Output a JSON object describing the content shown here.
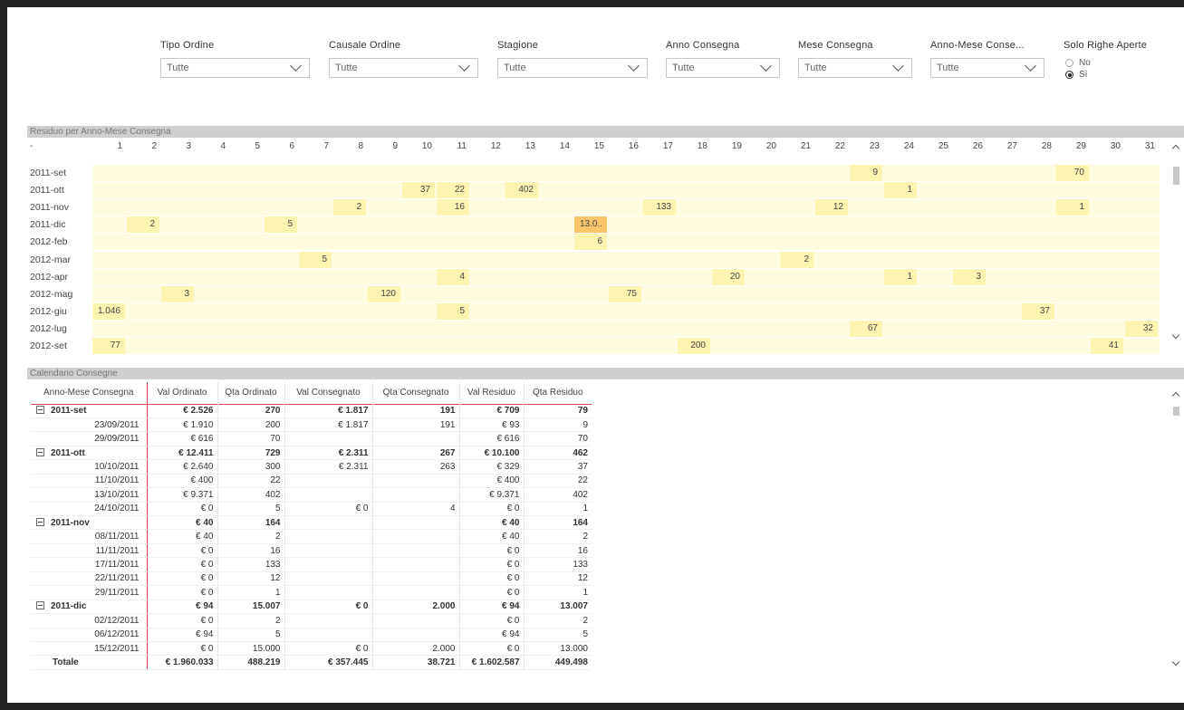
{
  "slicers": [
    {
      "title": "Tipo Ordine",
      "value": "Tutte"
    },
    {
      "title": "Causale Ordine",
      "value": "Tutte"
    },
    {
      "title": "Stagione",
      "value": "Tutte"
    },
    {
      "title": "Anno Consegna",
      "value": "Tutte"
    },
    {
      "title": "Mese Consegna",
      "value": "Tutte"
    },
    {
      "title": "Anno-Mese Conse...",
      "value": "Tutte"
    }
  ],
  "radio_slicer": {
    "title": "Solo Righe Aperte",
    "options": [
      {
        "label": "No",
        "selected": false
      },
      {
        "label": "Sì",
        "selected": true
      }
    ]
  },
  "matrix": {
    "title": "Residuo per Anno-Mese Consegna",
    "corner": "-",
    "days": [
      "1",
      "2",
      "3",
      "4",
      "5",
      "6",
      "7",
      "8",
      "9",
      "10",
      "11",
      "12",
      "13",
      "14",
      "15",
      "16",
      "17",
      "18",
      "19",
      "20",
      "21",
      "22",
      "23",
      "24",
      "25",
      "26",
      "27",
      "28",
      "29",
      "30",
      "31"
    ],
    "rows": [
      {
        "label": "2011-set",
        "cells": [
          {
            "day": 23,
            "value": "9"
          },
          {
            "day": 29,
            "value": "70"
          }
        ]
      },
      {
        "label": "2011-ott",
        "cells": [
          {
            "day": 10,
            "value": "37"
          },
          {
            "day": 11,
            "value": "22"
          },
          {
            "day": 13,
            "value": "402"
          },
          {
            "day": 24,
            "value": "1"
          }
        ]
      },
      {
        "label": "2011-nov",
        "cells": [
          {
            "day": 8,
            "value": "2"
          },
          {
            "day": 11,
            "value": "16"
          },
          {
            "day": 17,
            "value": "133"
          },
          {
            "day": 22,
            "value": "12"
          },
          {
            "day": 29,
            "value": "1"
          }
        ]
      },
      {
        "label": "2011-dic",
        "cells": [
          {
            "day": 2,
            "value": "2"
          },
          {
            "day": 6,
            "value": "5"
          },
          {
            "day": 15,
            "value": "13.0..",
            "highlight": true
          }
        ]
      },
      {
        "label": "2012-feb",
        "cells": [
          {
            "day": 15,
            "value": "6"
          }
        ]
      },
      {
        "label": "2012-mar",
        "cells": [
          {
            "day": 7,
            "value": "5"
          },
          {
            "day": 21,
            "value": "2"
          }
        ]
      },
      {
        "label": "2012-apr",
        "cells": [
          {
            "day": 11,
            "value": "4"
          },
          {
            "day": 19,
            "value": "20"
          },
          {
            "day": 24,
            "value": "1"
          },
          {
            "day": 26,
            "value": "3"
          }
        ]
      },
      {
        "label": "2012-mag",
        "cells": [
          {
            "day": 3,
            "value": "3"
          },
          {
            "day": 9,
            "value": "120"
          },
          {
            "day": 16,
            "value": "75"
          }
        ]
      },
      {
        "label": "2012-giu",
        "cells": [
          {
            "day": 1,
            "value": "1.046"
          },
          {
            "day": 11,
            "value": "5"
          },
          {
            "day": 28,
            "value": "37"
          }
        ]
      },
      {
        "label": "2012-lug",
        "cells": [
          {
            "day": 23,
            "value": "67"
          },
          {
            "day": 31,
            "value": "32"
          }
        ]
      },
      {
        "label": "2012-set",
        "cells": [
          {
            "day": 1,
            "value": "77"
          },
          {
            "day": 18,
            "value": "200"
          },
          {
            "day": 30,
            "value": "41"
          }
        ]
      }
    ],
    "colors": {
      "band": "#fffbe0",
      "cell": "#fff3b0",
      "highlight": "#fbc56a"
    }
  },
  "calendar": {
    "title": "Calendario Consegne",
    "columns": [
      "Anno-Mese Consegna",
      "Val Ordinato",
      "Qta Ordinato",
      "Val Consegnato",
      "Qta Consegnato",
      "Val Residuo",
      "Qta Residuo"
    ],
    "rows": [
      {
        "type": "grp",
        "cells": [
          "2011-set",
          "€ 2.526",
          "270",
          "€ 1.817",
          "191",
          "€ 709",
          "79"
        ]
      },
      {
        "type": "det",
        "cells": [
          "23/09/2011",
          "€ 1.910",
          "200",
          "€ 1.817",
          "191",
          "€ 93",
          "9"
        ]
      },
      {
        "type": "det",
        "cells": [
          "29/09/2011",
          "€ 616",
          "70",
          "",
          "",
          "€ 616",
          "70"
        ]
      },
      {
        "type": "grp",
        "cells": [
          "2011-ott",
          "€ 12.411",
          "729",
          "€ 2.311",
          "267",
          "€ 10.100",
          "462"
        ]
      },
      {
        "type": "det",
        "cells": [
          "10/10/2011",
          "€ 2.640",
          "300",
          "€ 2.311",
          "263",
          "€ 329",
          "37"
        ]
      },
      {
        "type": "det",
        "cells": [
          "11/10/2011",
          "€ 400",
          "22",
          "",
          "",
          "€ 400",
          "22"
        ]
      },
      {
        "type": "det",
        "cells": [
          "13/10/2011",
          "€ 9.371",
          "402",
          "",
          "",
          "€ 9.371",
          "402"
        ]
      },
      {
        "type": "det",
        "cells": [
          "24/10/2011",
          "€ 0",
          "5",
          "€ 0",
          "4",
          "€ 0",
          "1"
        ]
      },
      {
        "type": "grp",
        "cells": [
          "2011-nov",
          "€ 40",
          "164",
          "",
          "",
          "€ 40",
          "164"
        ]
      },
      {
        "type": "det",
        "cells": [
          "08/11/2011",
          "€ 40",
          "2",
          "",
          "",
          "€ 40",
          "2"
        ]
      },
      {
        "type": "det",
        "cells": [
          "11/11/2011",
          "€ 0",
          "16",
          "",
          "",
          "€ 0",
          "16"
        ]
      },
      {
        "type": "det",
        "cells": [
          "17/11/2011",
          "€ 0",
          "133",
          "",
          "",
          "€ 0",
          "133"
        ]
      },
      {
        "type": "det",
        "cells": [
          "22/11/2011",
          "€ 0",
          "12",
          "",
          "",
          "€ 0",
          "12"
        ]
      },
      {
        "type": "det",
        "cells": [
          "29/11/2011",
          "€ 0",
          "1",
          "",
          "",
          "€ 0",
          "1"
        ]
      },
      {
        "type": "grp",
        "cells": [
          "2011-dic",
          "€ 94",
          "15.007",
          "€ 0",
          "2.000",
          "€ 94",
          "13.007"
        ]
      },
      {
        "type": "det",
        "cells": [
          "02/12/2011",
          "€ 0",
          "2",
          "",
          "",
          "€ 0",
          "2"
        ]
      },
      {
        "type": "det",
        "cells": [
          "06/12/2011",
          "€ 94",
          "5",
          "",
          "",
          "€ 94",
          "5"
        ]
      },
      {
        "type": "det",
        "cells": [
          "15/12/2011",
          "€ 0",
          "15.000",
          "€ 0",
          "2.000",
          "€ 0",
          "13.000"
        ]
      }
    ],
    "total": [
      "Totale",
      "€ 1.960.033",
      "488.219",
      "€ 357.445",
      "38.721",
      "€ 1.602.587",
      "449.498"
    ]
  }
}
